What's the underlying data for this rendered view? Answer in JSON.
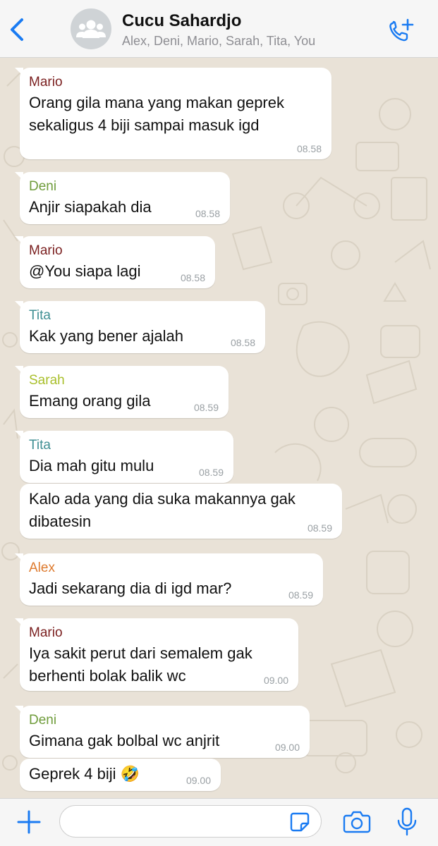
{
  "header": {
    "title": "Cucu Sahardjo",
    "members": "Alex, Deni, Mario, Sarah, Tita, You",
    "back_icon": "chevron-left-icon",
    "avatar_icon": "group-icon",
    "call_icon": "add-call-icon"
  },
  "colors": {
    "accent": "#1a7bf2",
    "Mario": "#7a1f1f",
    "Deni": "#6f9c3b",
    "Tita": "#3f8f93",
    "Sarah": "#a9bf2b",
    "Alex": "#dd7a2e"
  },
  "messages": [
    {
      "sender": "Mario",
      "text": "Orang gila mana yang makan geprek\nsekaligus 4 biji sampai masuk igd",
      "time": "08.58"
    },
    {
      "sender": "Deni",
      "text": "Anjir siapakah dia",
      "time": "08.58"
    },
    {
      "sender": "Mario",
      "text": "@You siapa lagi",
      "time": "08.58"
    },
    {
      "sender": "Tita",
      "text": "Kak yang bener ajalah",
      "time": "08.58"
    },
    {
      "sender": "Sarah",
      "text": "Emang orang gila",
      "time": "08.59"
    },
    {
      "sender": "Tita",
      "text": "Dia mah gitu mulu",
      "time": "08.59"
    },
    {
      "sender": "",
      "text": "Kalo ada yang dia suka makannya gak\ndibatesin",
      "time": "08.59"
    },
    {
      "sender": "Alex",
      "text": "Jadi sekarang dia di igd mar?",
      "time": "08.59"
    },
    {
      "sender": "Mario",
      "text": "Iya sakit perut dari semalem gak\nberhenti bolak balik wc",
      "time": "09.00"
    },
    {
      "sender": "Deni",
      "text": "Gimana gak bolbal wc anjrit",
      "time": "09.00"
    },
    {
      "sender": "",
      "text": "Geprek 4 biji 🤣",
      "time": "09.00"
    }
  ],
  "composer": {
    "value": "",
    "plus_icon": "plus-icon",
    "sticker_icon": "sticker-icon",
    "camera_icon": "camera-icon",
    "mic_icon": "microphone-icon"
  }
}
